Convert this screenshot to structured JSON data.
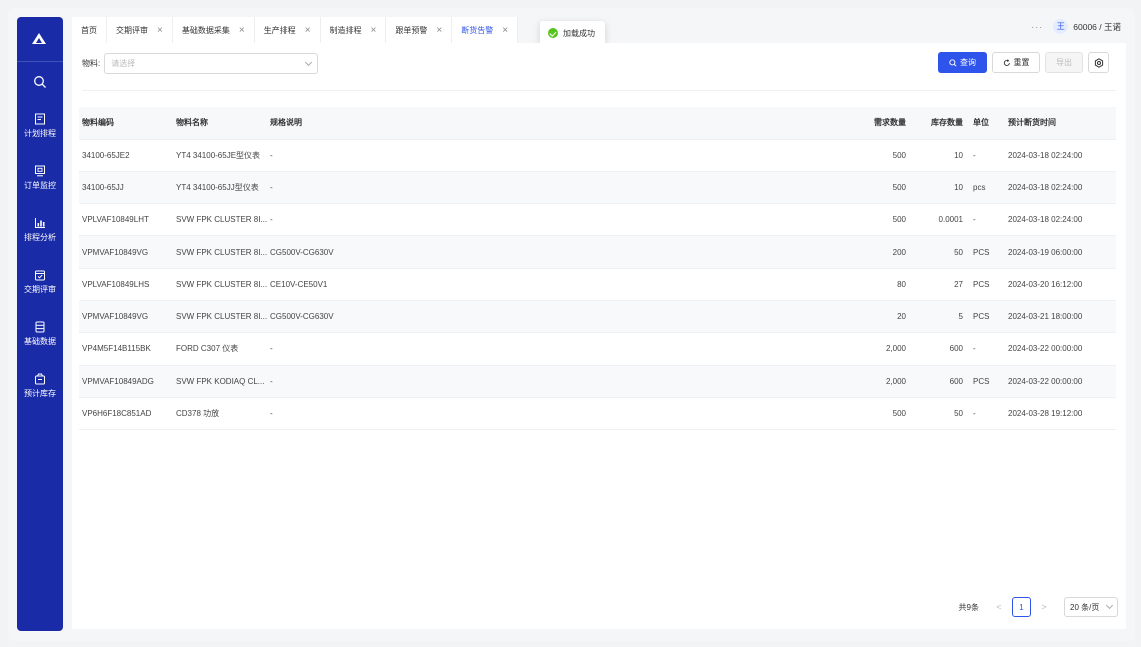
{
  "sidebar": {
    "items": [
      {
        "label": "计划排程",
        "icon": "plan-icon"
      },
      {
        "label": "订单监控",
        "icon": "monitor-icon"
      },
      {
        "label": "排程分析",
        "icon": "chart-icon"
      },
      {
        "label": "交期评审",
        "icon": "calendar-check-icon"
      },
      {
        "label": "基础数据",
        "icon": "database-icon"
      },
      {
        "label": "预计库存",
        "icon": "inventory-icon"
      }
    ]
  },
  "tabs": [
    {
      "label": "首页",
      "closable": false
    },
    {
      "label": "交期评审",
      "closable": true
    },
    {
      "label": "基础数据采集",
      "closable": true
    },
    {
      "label": "生产排程",
      "closable": true
    },
    {
      "label": "制造排程",
      "closable": true
    },
    {
      "label": "跟单预警",
      "closable": true
    },
    {
      "label": "断货告警",
      "closable": true,
      "active": true
    }
  ],
  "toast": {
    "text": "加载成功"
  },
  "user": {
    "avatar": "王",
    "name": "60006 / 王诺",
    "more": "···"
  },
  "filter": {
    "label": "物料:",
    "placeholder": "请选择"
  },
  "actions": {
    "query": "查询",
    "reset": "重置",
    "export": "导出"
  },
  "table": {
    "headers": [
      "物料编码",
      "物料名称",
      "规格说明",
      "需求数量",
      "库存数量",
      "单位",
      "预计断货时间"
    ],
    "rows": [
      [
        "34100-65JE2",
        "YT4 34100-65JE型仪表",
        "-",
        "500",
        "10",
        "-",
        "2024-03-18 02:24:00"
      ],
      [
        "34100-65JJ",
        "YT4 34100-65JJ型仪表",
        "-",
        "500",
        "10",
        "pcs",
        "2024-03-18 02:24:00"
      ],
      [
        "VPLVAF10849LHT",
        "SVW FPK CLUSTER 8I...",
        "-",
        "500",
        "0.0001",
        "-",
        "2024-03-18 02:24:00"
      ],
      [
        "VPMVAF10849VG",
        "SVW FPK CLUSTER 8I...",
        "CG500V-CG630V",
        "200",
        "50",
        "PCS",
        "2024-03-19 06:00:00"
      ],
      [
        "VPLVAF10849LHS",
        "SVW FPK CLUSTER 8I...",
        "CE10V-CE50V1",
        "80",
        "27",
        "PCS",
        "2024-03-20 16:12:00"
      ],
      [
        "VPMVAF10849VG",
        "SVW FPK CLUSTER 8I...",
        "CG500V-CG630V",
        "20",
        "5",
        "PCS",
        "2024-03-21 18:00:00"
      ],
      [
        "VP4M5F14B115BK",
        "FORD C307 仪表",
        "-",
        "2,000",
        "600",
        "-",
        "2024-03-22 00:00:00"
      ],
      [
        "VPMVAF10849ADG",
        "SVW FPK KODIAQ CL...",
        "-",
        "2,000",
        "600",
        "PCS",
        "2024-03-22 00:00:00"
      ],
      [
        "VP6H6F18C851AD",
        "CD378 功放",
        "-",
        "500",
        "50",
        "-",
        "2024-03-28 19:12:00"
      ]
    ]
  },
  "pagination": {
    "total": "共9条",
    "current": "1",
    "page_size": "20 条/页"
  }
}
